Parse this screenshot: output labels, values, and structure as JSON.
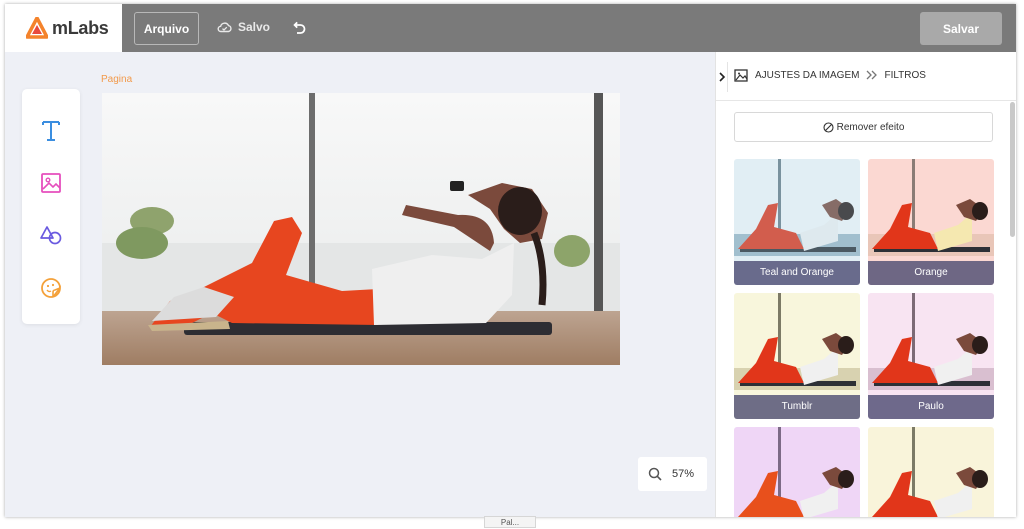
{
  "topbar": {
    "logo_text": "mLabs",
    "arquivo_label": "Arquivo",
    "saved_label": "Salvo",
    "salvar_label": "Salvar"
  },
  "editor": {
    "page_label": "Pagina",
    "zoom_label": "57%",
    "bottom_tab": "Pal..."
  },
  "panel": {
    "crumb_image": "AJUSTES DA IMAGEM",
    "crumb_filters": "FILTROS",
    "remove_label": "Remover efeito",
    "filters": [
      {
        "label": "Teal and Orange",
        "tint": "#a9d4e6"
      },
      {
        "label": "Orange",
        "tint": "#f7c7c0"
      },
      {
        "label": "Tumblr",
        "tint": "#f5f2cf"
      },
      {
        "label": "Paulo",
        "tint": "#f2d9ec"
      },
      {
        "label": "",
        "tint": "#e7cdf2"
      },
      {
        "label": "",
        "tint": "#f6f0cf"
      }
    ]
  },
  "colors": {
    "topbar": "#7a7a7a",
    "accent_orange": "#f29a4b",
    "tool_blue": "#3b8ee0",
    "tool_pink": "#e64fbd",
    "tool_violet": "#6a5ae0",
    "tool_amber": "#f4a13a"
  },
  "icons": [
    "logo-icon",
    "cloud-check-icon",
    "undo-icon",
    "text-tool-icon",
    "image-tool-icon",
    "shapes-tool-icon",
    "sticker-tool-icon",
    "magnifier-icon",
    "chevron-right-icon",
    "image-icon",
    "double-chevron-icon",
    "no-effect-icon"
  ]
}
